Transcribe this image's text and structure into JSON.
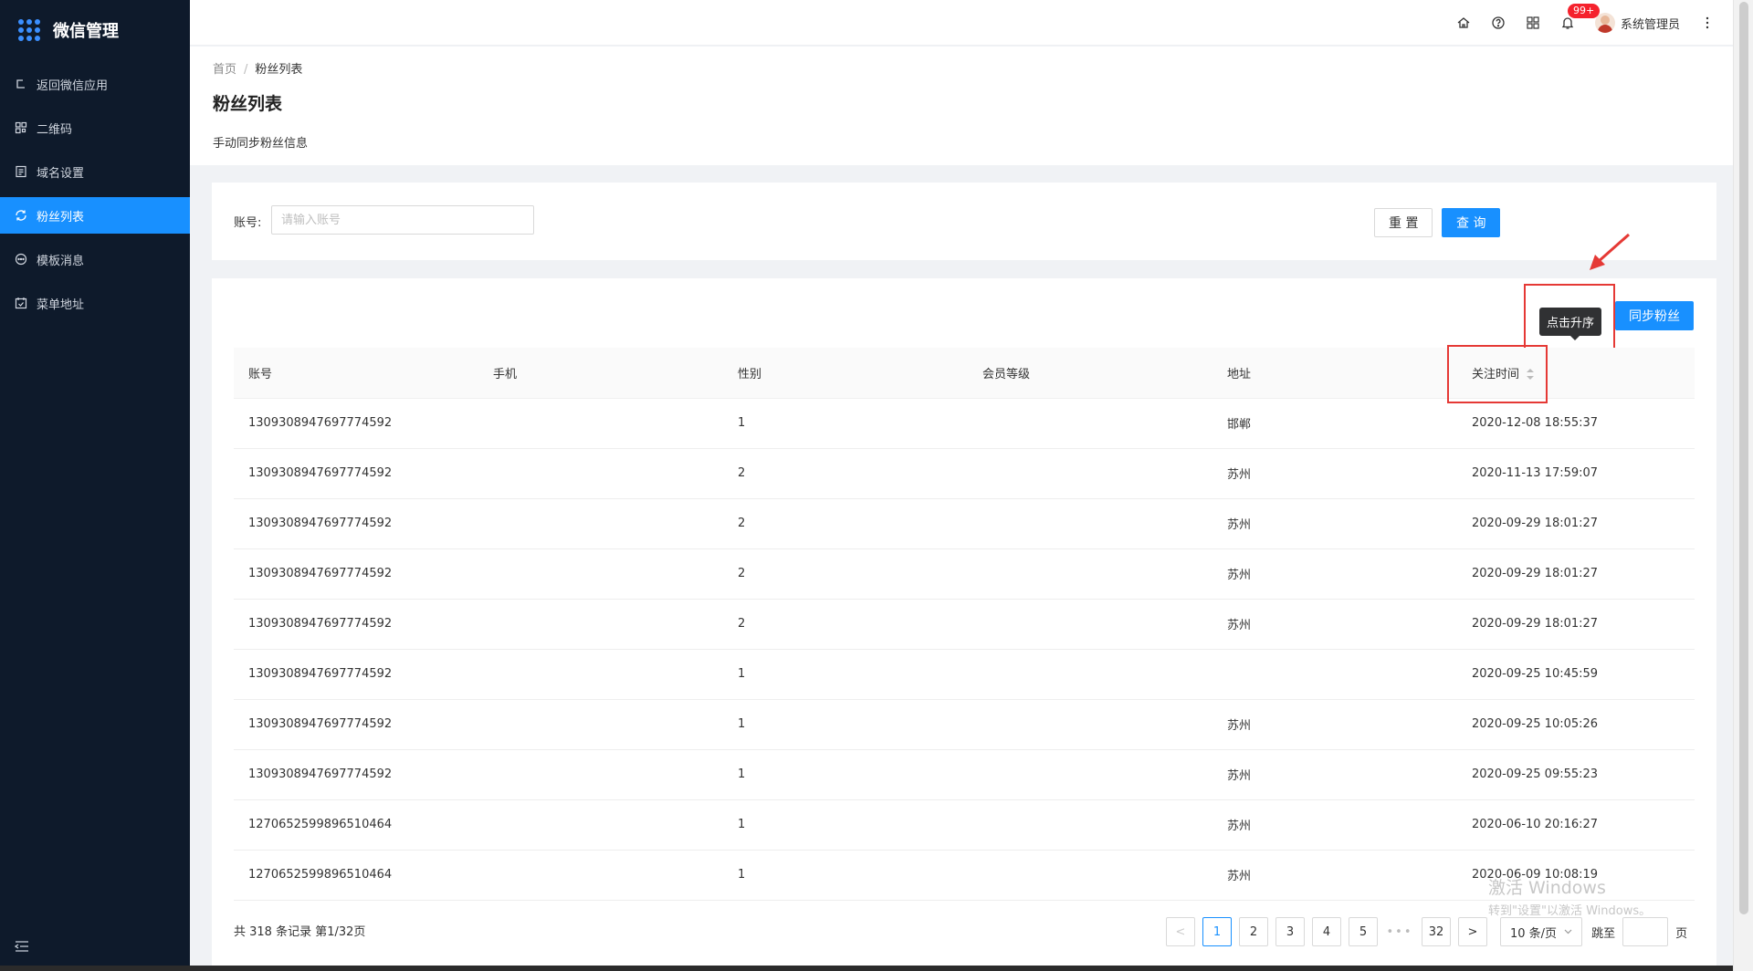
{
  "app": {
    "title": "微信管理"
  },
  "sidebar": {
    "items": [
      {
        "label": "返回微信应用",
        "icon": "return-icon"
      },
      {
        "label": "二维码",
        "icon": "qrcode-icon"
      },
      {
        "label": "域名设置",
        "icon": "document-icon"
      },
      {
        "label": "粉丝列表",
        "icon": "sync-icon",
        "active": true
      },
      {
        "label": "模板消息",
        "icon": "message-icon"
      },
      {
        "label": "菜单地址",
        "icon": "calendar-check-icon"
      }
    ]
  },
  "header": {
    "notification_count": "99+",
    "user_name": "系统管理员"
  },
  "breadcrumb": {
    "home": "首页",
    "separator": "/",
    "current": "粉丝列表"
  },
  "page": {
    "title": "粉丝列表",
    "description": "手动同步粉丝信息"
  },
  "search": {
    "label": "账号:",
    "placeholder": "请输入账号",
    "reset_label": "重 置",
    "query_label": "查 询"
  },
  "table": {
    "sync_label": "同步粉丝",
    "tooltip": "点击升序",
    "columns": [
      "账号",
      "手机",
      "性别",
      "会员等级",
      "地址",
      "关注时间"
    ],
    "rows": [
      [
        "1309308947697774592",
        "",
        "1",
        "",
        "邯郸",
        "2020-12-08 18:55:37"
      ],
      [
        "1309308947697774592",
        "",
        "2",
        "",
        "苏州",
        "2020-11-13 17:59:07"
      ],
      [
        "1309308947697774592",
        "",
        "2",
        "",
        "苏州",
        "2020-09-29 18:01:27"
      ],
      [
        "1309308947697774592",
        "",
        "2",
        "",
        "苏州",
        "2020-09-29 18:01:27"
      ],
      [
        "1309308947697774592",
        "",
        "2",
        "",
        "苏州",
        "2020-09-29 18:01:27"
      ],
      [
        "1309308947697774592",
        "",
        "1",
        "",
        "",
        "2020-09-25 10:45:59"
      ],
      [
        "1309308947697774592",
        "",
        "1",
        "",
        "苏州",
        "2020-09-25 10:05:26"
      ],
      [
        "1309308947697774592",
        "",
        "1",
        "",
        "苏州",
        "2020-09-25 09:55:23"
      ],
      [
        "1270652599896510464",
        "",
        "1",
        "",
        "苏州",
        "2020-06-10 20:16:27"
      ],
      [
        "1270652599896510464",
        "",
        "1",
        "",
        "苏州",
        "2020-06-09 10:08:19"
      ]
    ]
  },
  "pagination": {
    "summary": "共 318 条记录 第1/32页",
    "pages": [
      "1",
      "2",
      "3",
      "4",
      "5"
    ],
    "ellipsis": "•••",
    "last_page": "32",
    "prev": "<",
    "next": ">",
    "page_size": "10 条/页",
    "jump_label": "跳至",
    "page_suffix": "页"
  },
  "watermark": {
    "line1": "激活 Windows",
    "line2": "转到\"设置\"以激活 Windows。"
  },
  "colors": {
    "sidebar_bg": "#0e1a2b",
    "accent": "#1890ff",
    "highlight": "#e53935"
  }
}
